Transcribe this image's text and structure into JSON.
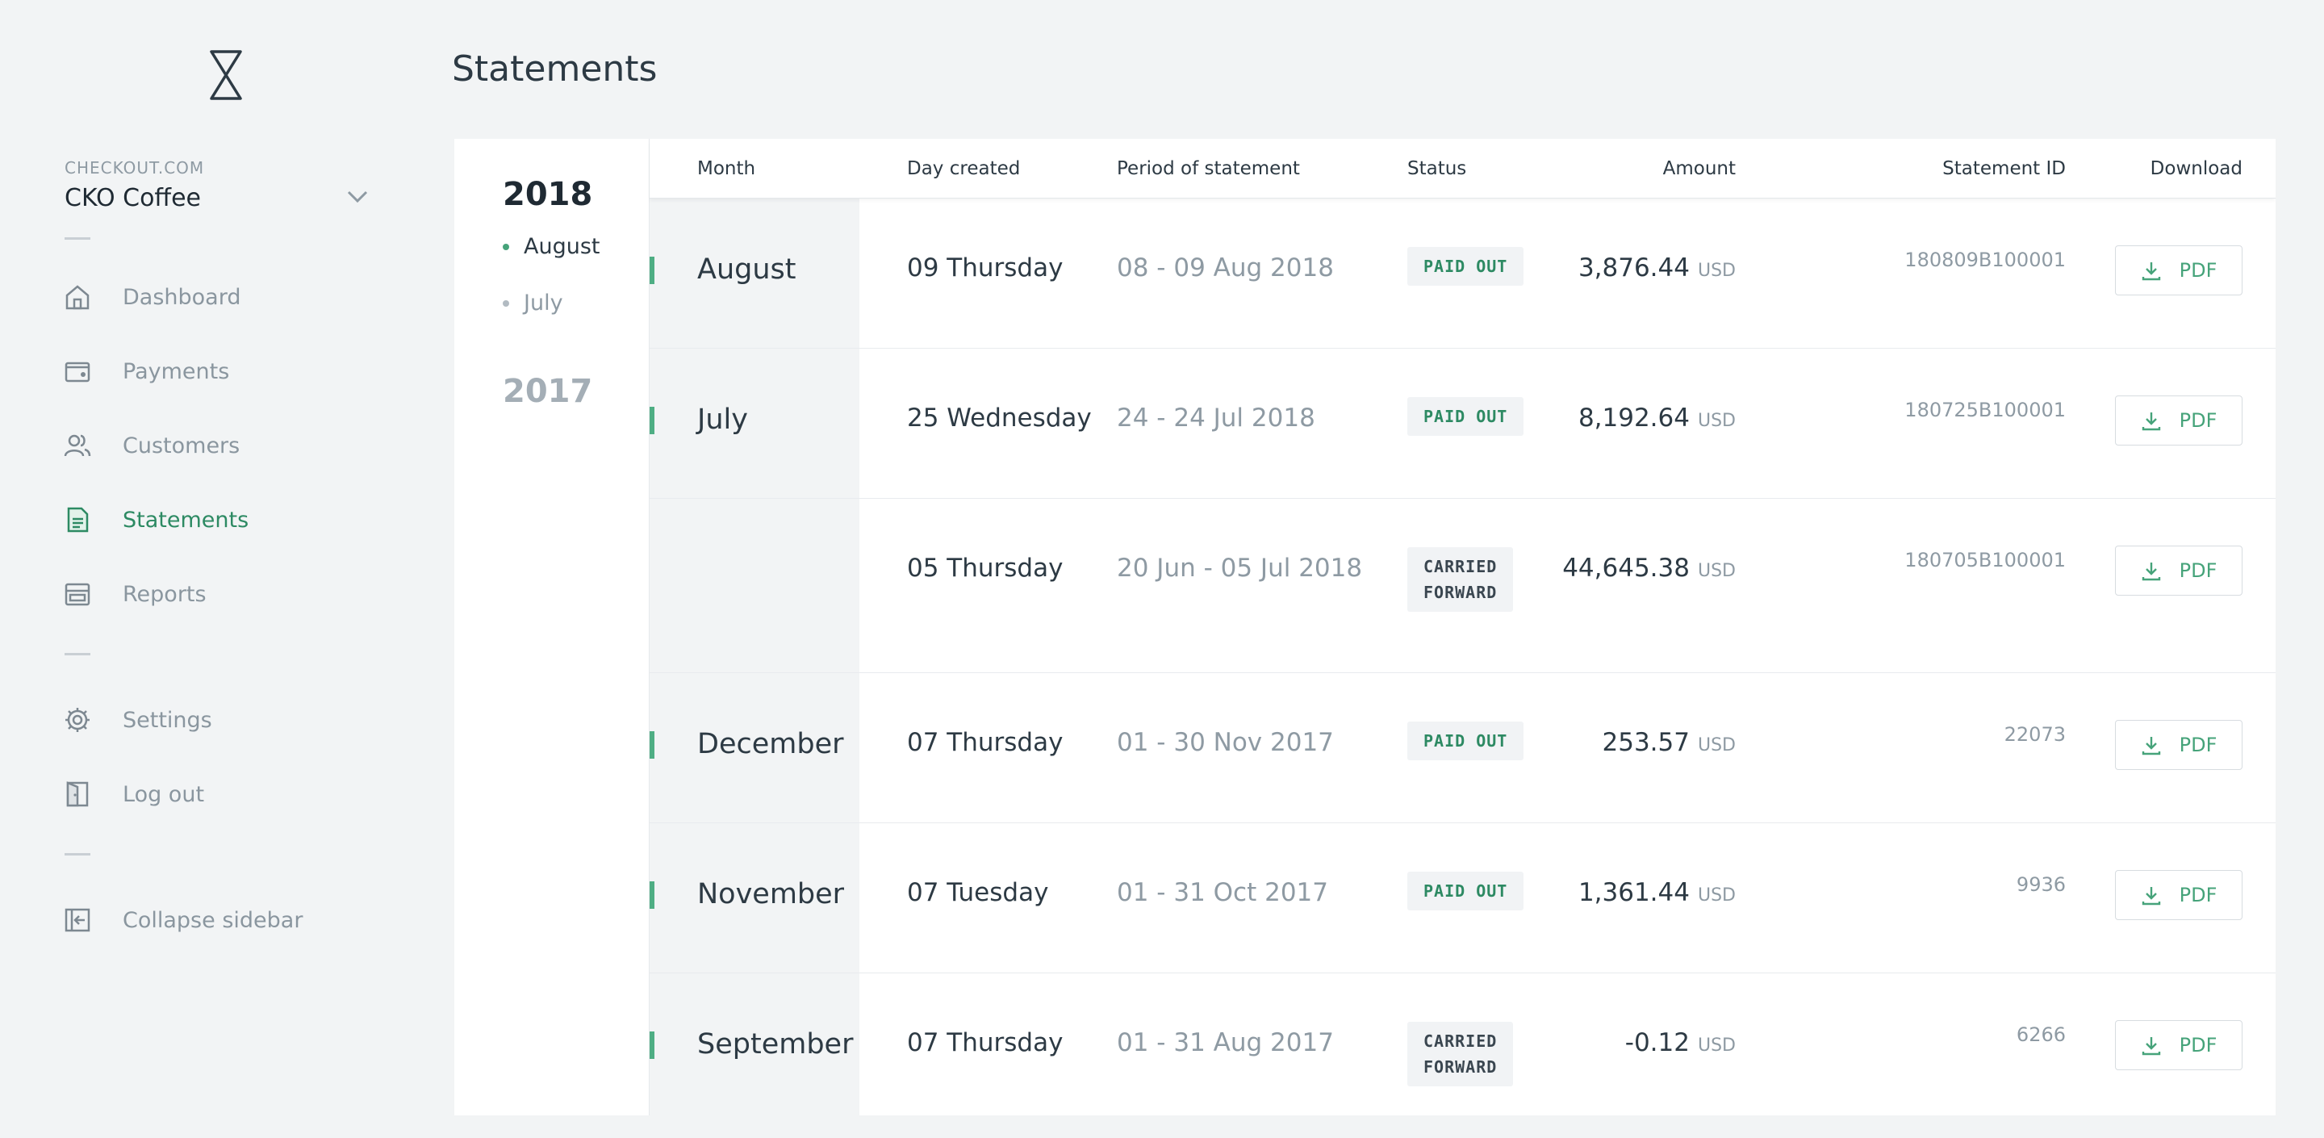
{
  "sidebar": {
    "merchant_label": "CHECKOUT.COM",
    "merchant_name": "CKO Coffee",
    "items": [
      {
        "label": "Dashboard",
        "icon": "home-icon"
      },
      {
        "label": "Payments",
        "icon": "wallet-icon"
      },
      {
        "label": "Customers",
        "icon": "users-icon"
      },
      {
        "label": "Statements",
        "icon": "document-icon",
        "active": true
      },
      {
        "label": "Reports",
        "icon": "archive-icon"
      }
    ],
    "settings_label": "Settings",
    "logout_label": "Log out",
    "collapse_label": "Collapse sidebar"
  },
  "page": {
    "title": "Statements"
  },
  "years": [
    {
      "year": "2018",
      "months": [
        "August",
        "July"
      ]
    },
    {
      "year": "2017"
    }
  ],
  "table": {
    "headers": {
      "month": "Month",
      "day": "Day created",
      "period": "Period of statement",
      "status": "Status",
      "amount": "Amount",
      "sid": "Statement ID",
      "download": "Download"
    },
    "rows": [
      {
        "month": "August",
        "day": "09 Thursday",
        "period": "08 - 09 Aug 2018",
        "status": "PAID OUT",
        "amount": "3,876.44",
        "currency": "USD",
        "sid": "180809B100001",
        "download": "PDF"
      },
      {
        "month": "July",
        "day": "25 Wednesday",
        "period": "24 - 24 Jul 2018",
        "status": "PAID OUT",
        "amount": "8,192.64",
        "currency": "USD",
        "sid": "180725B100001",
        "download": "PDF"
      },
      {
        "month": "",
        "day": "05 Thursday",
        "period": "20 Jun - 05 Jul 2018",
        "status": "CARRIED\nFORWARD",
        "amount": "44,645.38",
        "currency": "USD",
        "sid": "180705B100001",
        "download": "PDF"
      },
      {
        "month": "December",
        "day": "07 Thursday",
        "period": "01 - 30 Nov 2017",
        "status": "PAID OUT",
        "amount": "253.57",
        "currency": "USD",
        "sid": "22073",
        "download": "PDF"
      },
      {
        "month": "November",
        "day": "07 Tuesday",
        "period": "01 - 31 Oct 2017",
        "status": "PAID OUT",
        "amount": "1,361.44",
        "currency": "USD",
        "sid": "9936",
        "download": "PDF"
      },
      {
        "month": "September",
        "day": "07 Thursday",
        "period": "01 - 31 Aug 2017",
        "status": "CARRIED\nFORWARD",
        "amount": "-0.12",
        "currency": "USD",
        "sid": "6266",
        "download": "PDF"
      }
    ]
  },
  "colors": {
    "accent": "#46a37a",
    "active_text": "#2d8a63",
    "background": "#f2f4f5"
  }
}
